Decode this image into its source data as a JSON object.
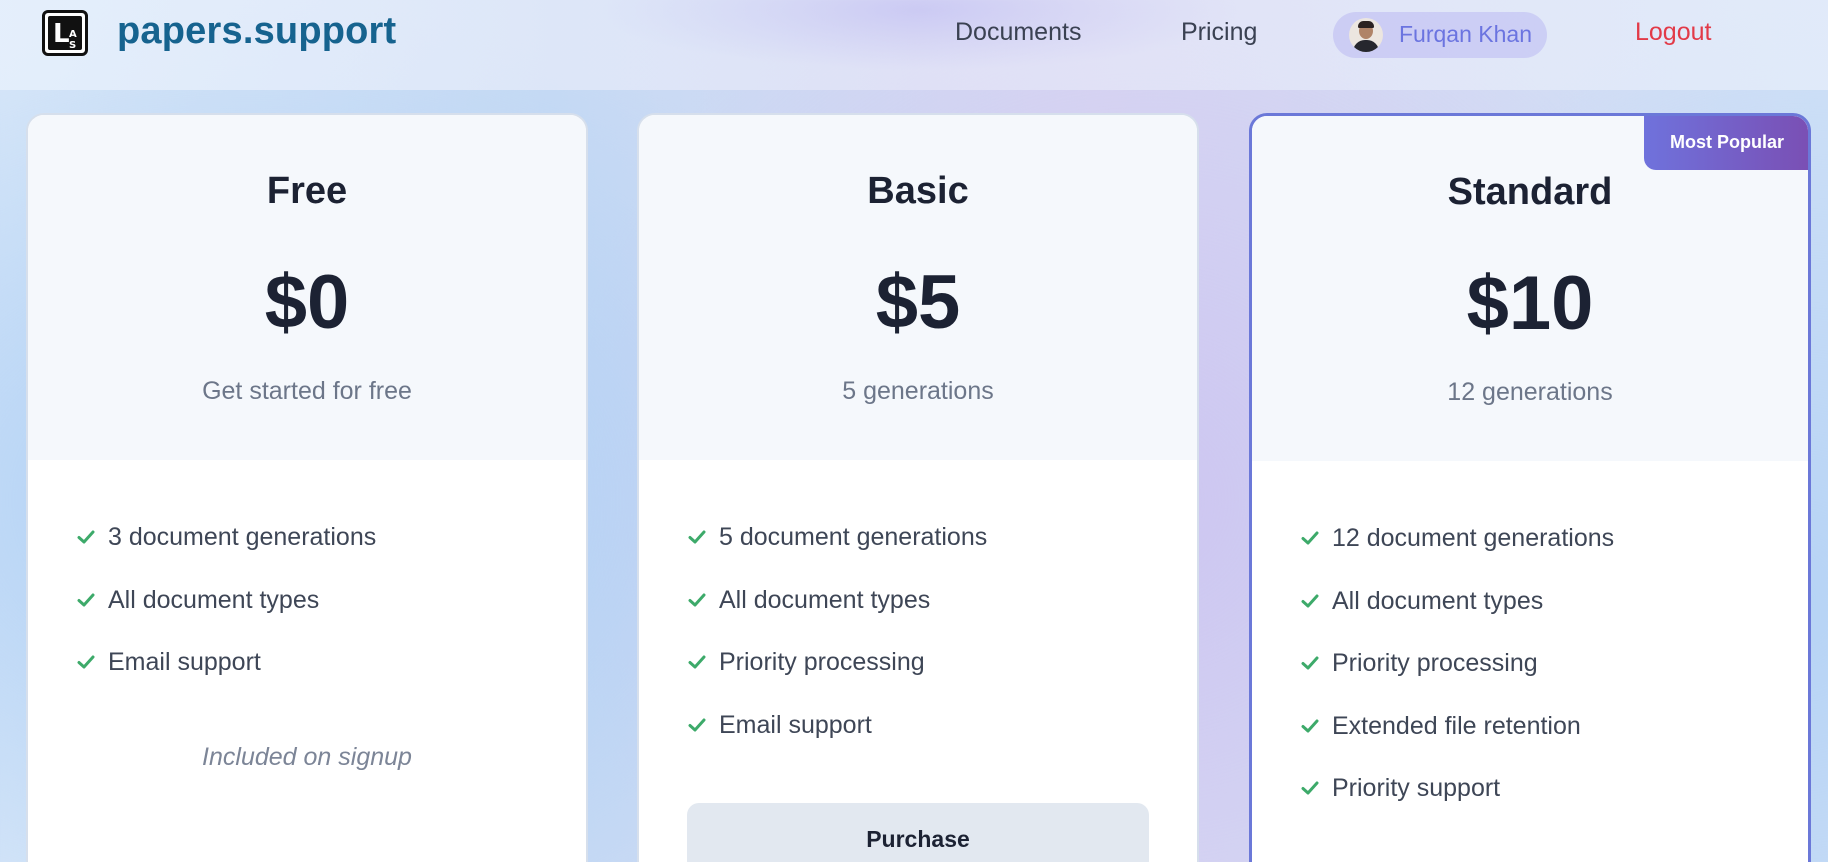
{
  "header": {
    "brand": "papers.support",
    "logo_letters": [
      "L",
      "A",
      "S"
    ],
    "nav": [
      {
        "label": "Documents"
      },
      {
        "label": "Pricing"
      }
    ],
    "user": {
      "name": "Furqan Khan"
    },
    "logout_label": "Logout"
  },
  "icons": {
    "check": "check-icon"
  },
  "colors": {
    "brand": "#16638f",
    "accent": "#6b74e0",
    "logout": "#e23a48",
    "check": "#3daa6a",
    "badge_start": "#6f72dc",
    "badge_end": "#7a4fb4"
  },
  "plans": [
    {
      "name": "Free",
      "price": "$0",
      "subtitle": "Get started for free",
      "features": [
        "3 document generations",
        "All document types",
        "Email support"
      ],
      "note": "Included on signup"
    },
    {
      "name": "Basic",
      "price": "$5",
      "subtitle": "5 generations",
      "features": [
        "5 document generations",
        "All document types",
        "Priority processing",
        "Email support"
      ],
      "action_label": "Purchase"
    },
    {
      "name": "Standard",
      "price": "$10",
      "subtitle": "12 generations",
      "badge": "Most Popular",
      "features": [
        "12 document generations",
        "All document types",
        "Priority processing",
        "Extended file retention",
        "Priority support"
      ]
    }
  ]
}
